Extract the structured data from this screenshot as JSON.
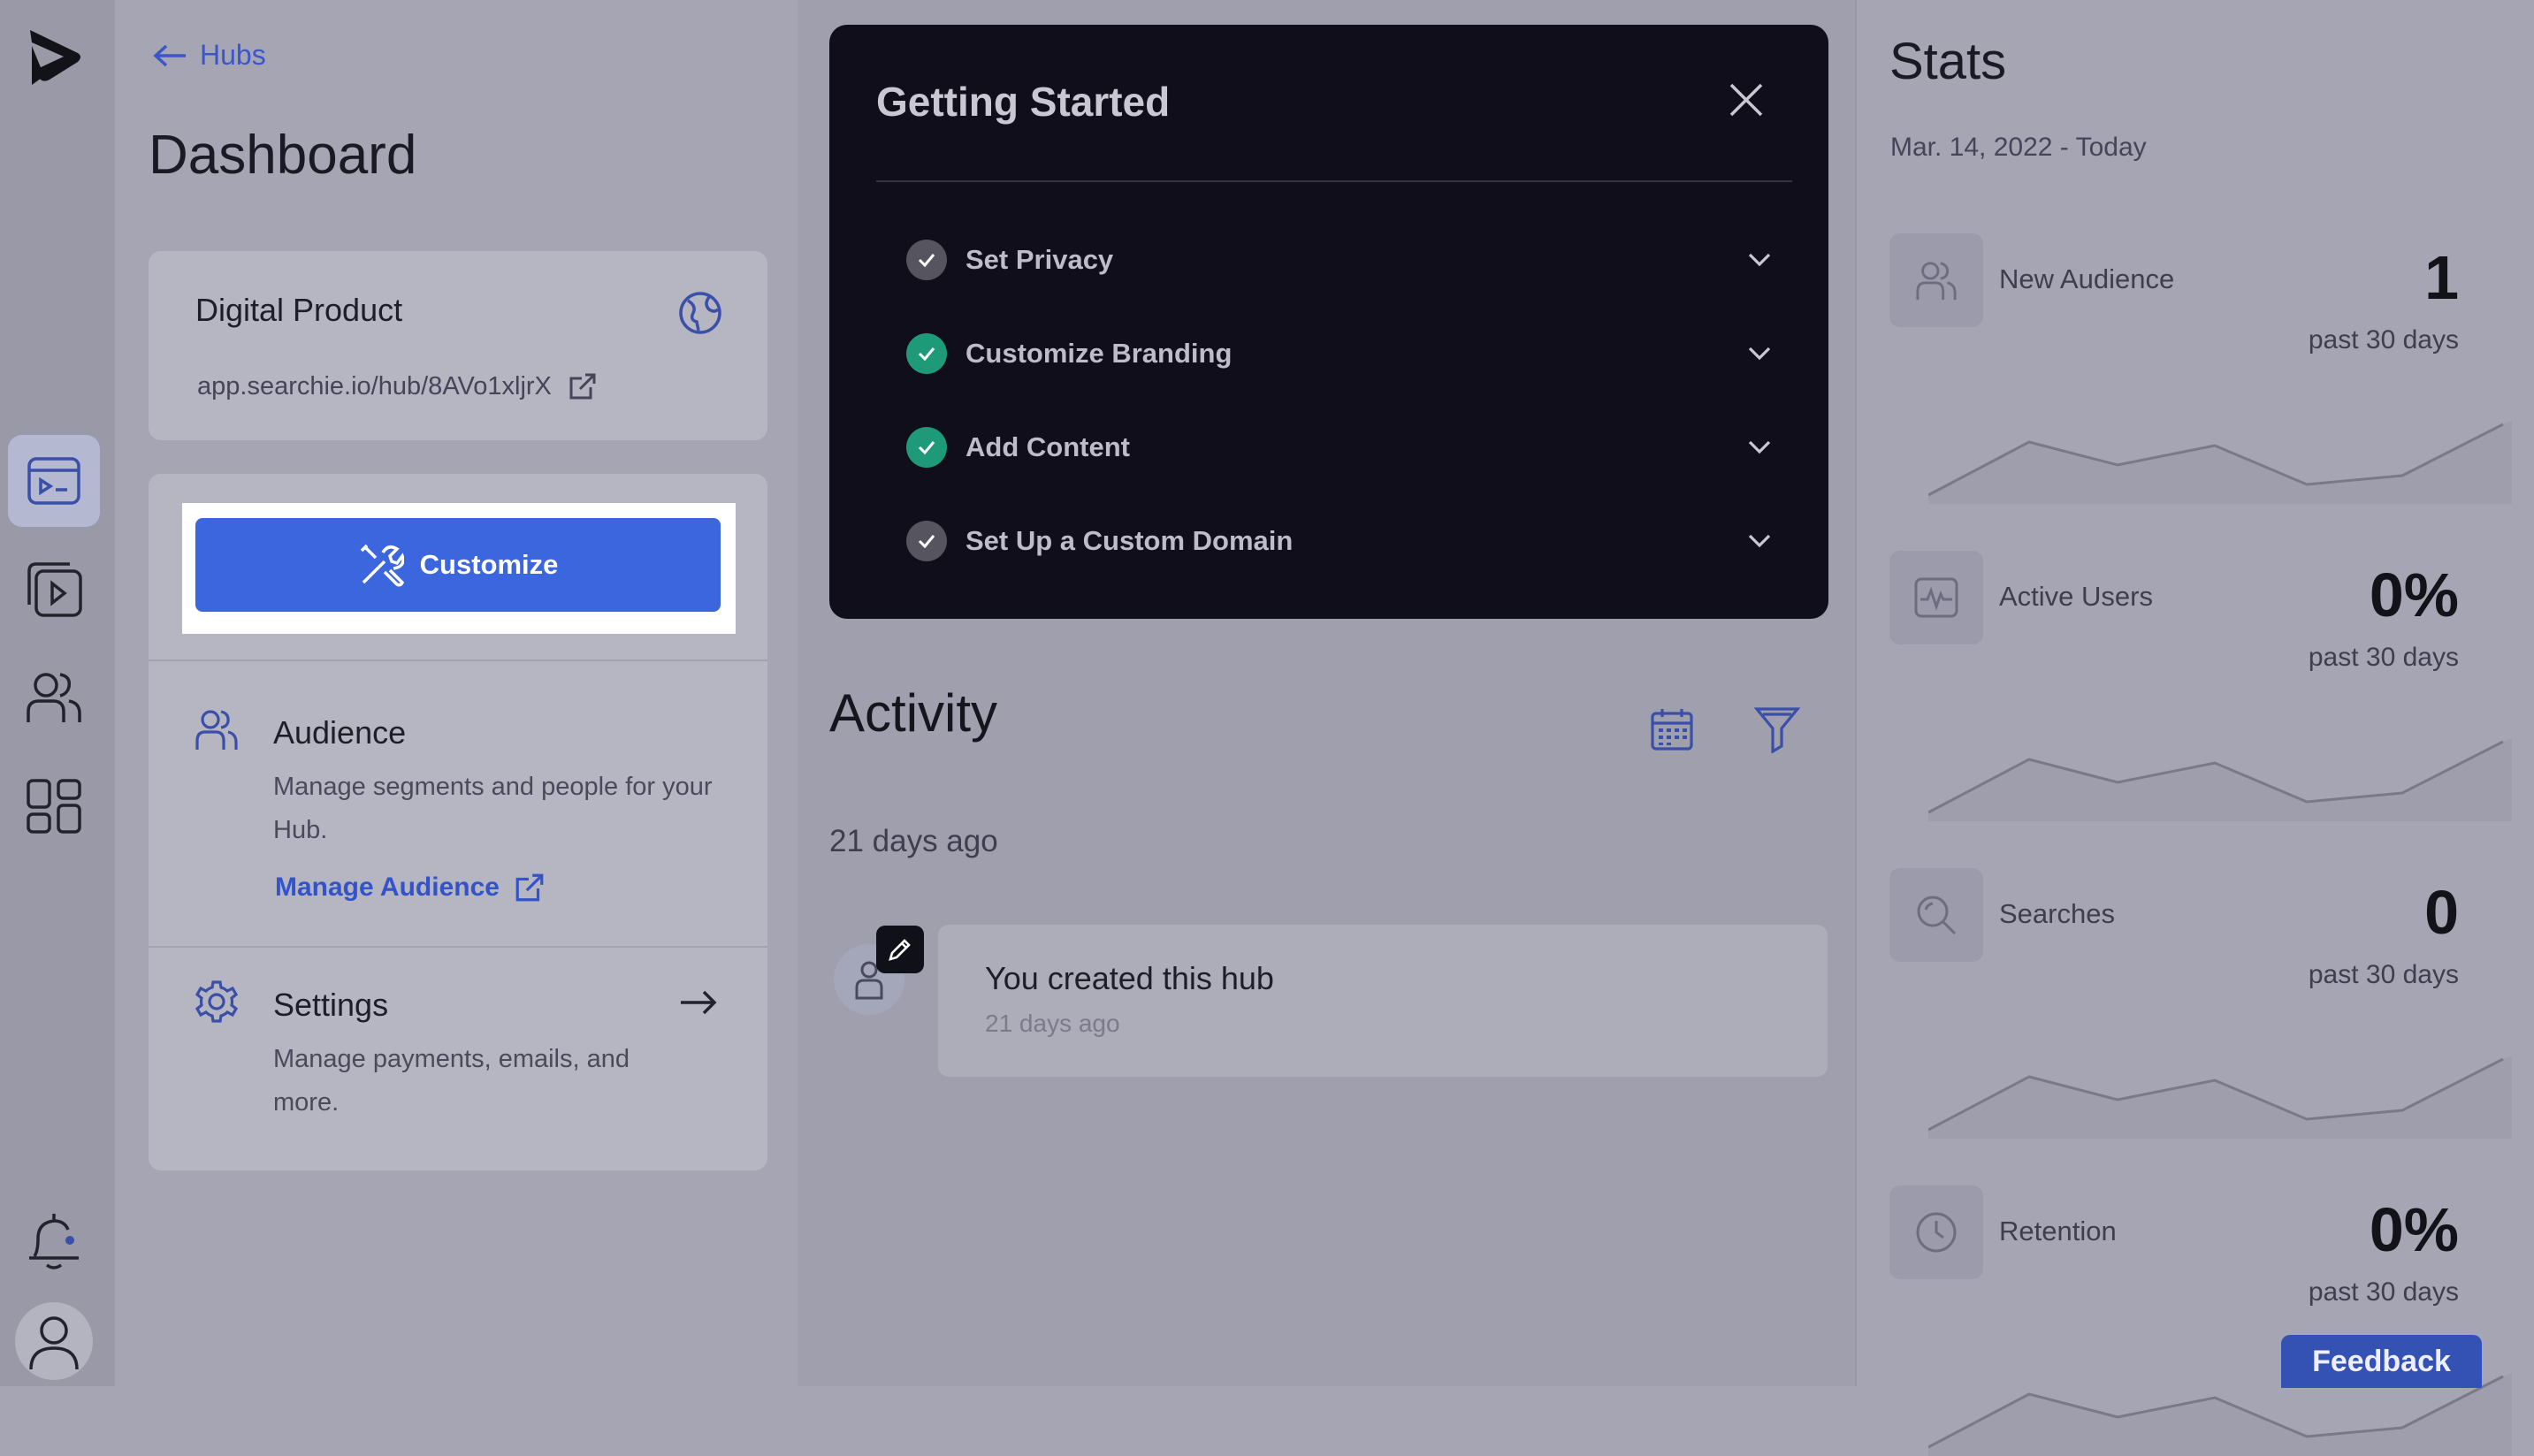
{
  "nav": {
    "back_label": "Hubs",
    "page_title": "Dashboard"
  },
  "hub": {
    "name": "Digital Product",
    "url": "app.searchie.io/hub/8AVo1xljrX"
  },
  "customize": {
    "label": "Customize"
  },
  "audience": {
    "title": "Audience",
    "description": "Manage segments and people for your Hub.",
    "link_label": "Manage Audience"
  },
  "settings": {
    "title": "Settings",
    "description": "Manage payments, emails, and more."
  },
  "getting_started": {
    "title": "Getting Started",
    "steps": [
      {
        "label": "Set Privacy",
        "done": false
      },
      {
        "label": "Customize Branding",
        "done": true
      },
      {
        "label": "Add Content",
        "done": true
      },
      {
        "label": "Set Up a Custom Domain",
        "done": false
      }
    ]
  },
  "activity": {
    "title": "Activity",
    "group_time": "21 days ago",
    "items": [
      {
        "text": "You created this hub",
        "time": "21 days ago"
      }
    ]
  },
  "stats": {
    "title": "Stats",
    "range": "Mar. 14, 2022 - Today",
    "cards": [
      {
        "label": "New Audience",
        "value": "1",
        "period": "past 30 days",
        "icon": "users-icon"
      },
      {
        "label": "Active Users",
        "value": "0%",
        "period": "past 30 days",
        "icon": "pulse-icon"
      },
      {
        "label": "Searches",
        "value": "0",
        "period": "past 30 days",
        "icon": "search-icon"
      },
      {
        "label": "Retention",
        "value": "0%",
        "period": "past 30 days",
        "icon": "clock-icon"
      }
    ]
  },
  "feedback": {
    "label": "Feedback"
  },
  "colors": {
    "accent": "#3c66de",
    "check_done": "#1f9a78",
    "check_pending": "#55545f",
    "panel_dark": "#0f0e1a"
  }
}
